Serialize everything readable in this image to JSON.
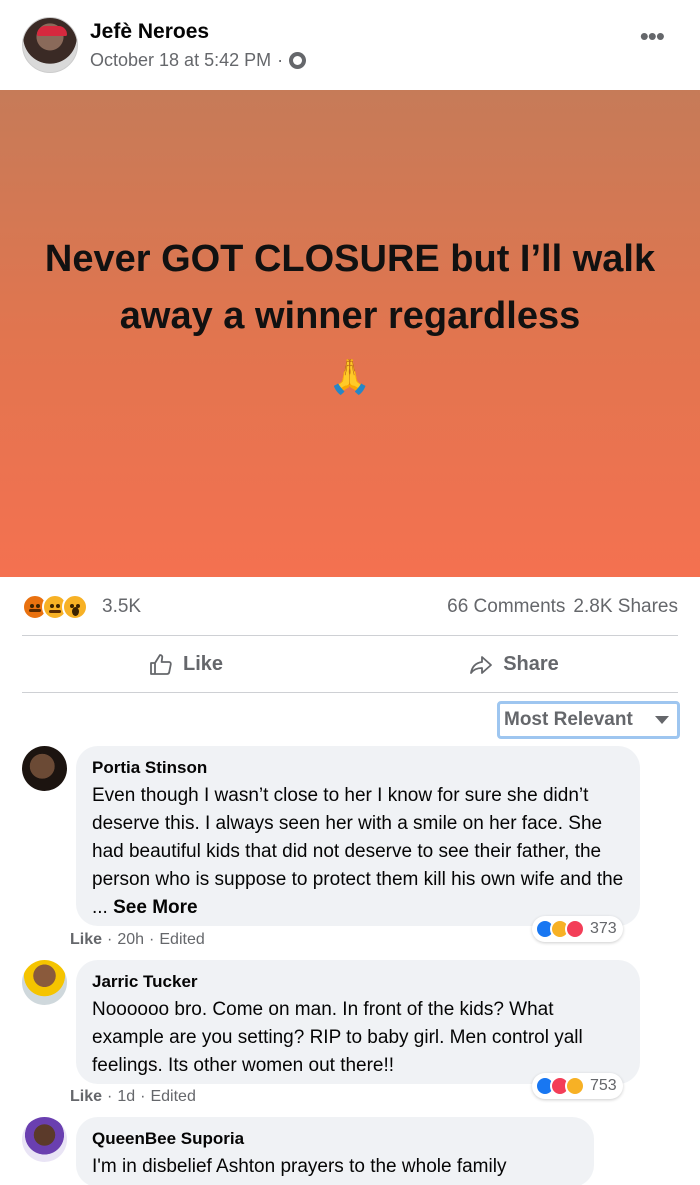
{
  "post": {
    "author": "Jefè Neroes",
    "timestamp": "October 18 at 5:42 PM",
    "separator": "·",
    "more_label": "•••",
    "text": "Never GOT CLOSURE but I’ll walk away a winner regardless",
    "emoji": "🙏"
  },
  "stats": {
    "reaction_count": "3.5K",
    "comments": "66 Comments",
    "shares": "2.8K Shares",
    "reactions": [
      "angry-icon",
      "sad-icon",
      "wow-icon"
    ]
  },
  "actions": {
    "like_label": "Like",
    "share_label": "Share"
  },
  "sort": {
    "label": "Most Relevant"
  },
  "comments": [
    {
      "name": "Portia Stinson",
      "text": "Even though I wasn’t close to her I know for sure she didn’t deserve this. I always seen her with a smile on her face. She had beautiful kids that did not deserve to see their father, the person who is suppose to protect them kill his own wife and the ... ",
      "see_more": "See More",
      "like": "Like",
      "age": "20h",
      "edited": "Edited",
      "reactions_count": "373"
    },
    {
      "name": "Jarric Tucker",
      "text": "Noooooo bro. Come on man. In front of the kids? What example are you setting? RIP to baby girl. Men control yall feelings. Its other women out there!!",
      "like": "Like",
      "age": "1d",
      "edited": "Edited",
      "reactions_count": "753"
    },
    {
      "name": "QueenBee Suporia",
      "text": "I'm in disbelief Ashton prayers to the whole family"
    }
  ],
  "colors": {
    "accent": "#1877f2",
    "secondary_text": "#65676b",
    "bubble": "#f0f2f5",
    "post_bg_top": "#c67b58",
    "post_bg_bottom": "#f47150"
  }
}
